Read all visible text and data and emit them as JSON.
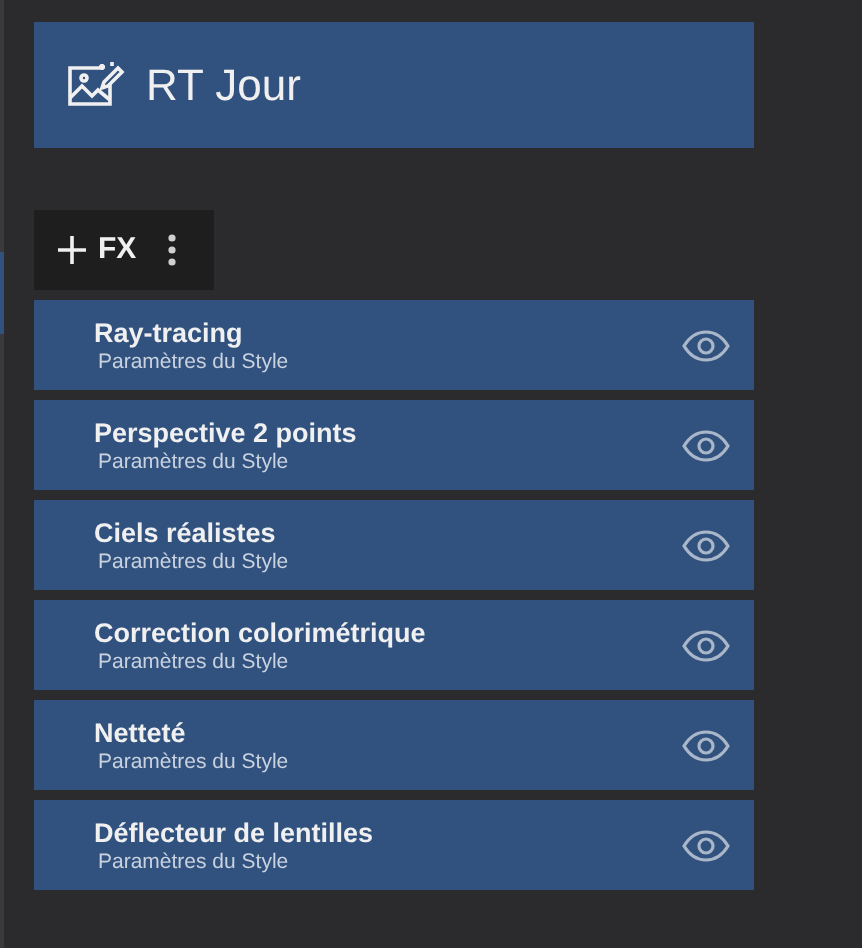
{
  "header": {
    "title": "RT Jour"
  },
  "toolbar": {
    "add_label": "FX"
  },
  "effects": [
    {
      "name": "Ray-tracing",
      "subtitle": "Paramètres du Style",
      "visible": true
    },
    {
      "name": "Perspective 2 points",
      "subtitle": "Paramètres du Style",
      "visible": true
    },
    {
      "name": "Ciels réalistes",
      "subtitle": "Paramètres du Style",
      "visible": true
    },
    {
      "name": "Correction colorimétrique",
      "subtitle": "Paramètres du Style",
      "visible": true
    },
    {
      "name": "Netteté",
      "subtitle": "Paramètres du Style",
      "visible": true
    },
    {
      "name": "Déflecteur de lentilles",
      "subtitle": "Paramètres du Style",
      "visible": true
    }
  ]
}
